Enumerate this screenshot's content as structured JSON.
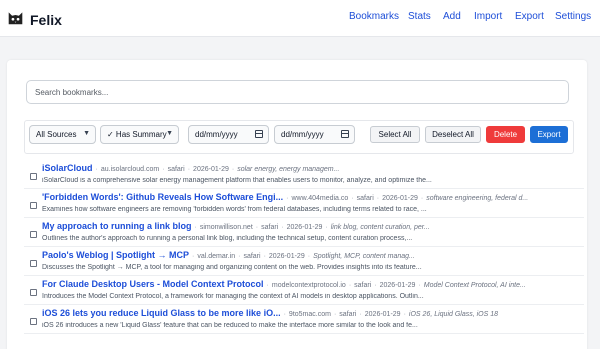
{
  "app": {
    "name": "Felix",
    "logo_icon": "cat-face-icon"
  },
  "nav": {
    "bookmarks": "Bookmarks",
    "stats": "Stats",
    "add": "Add",
    "import": "Import",
    "export": "Export",
    "settings": "Settings"
  },
  "search": {
    "placeholder": "Search bookmarks...",
    "value": ""
  },
  "filters": {
    "source": "All Sources",
    "summary": "✓ Has Summary",
    "date_from": "dd/mm/yyyy",
    "date_to": "dd/mm/yyyy",
    "select_all": "Select All",
    "deselect_all": "Deselect All",
    "delete": "Delete",
    "export": "Export"
  },
  "colors": {
    "accent": "#1d4ed8",
    "delete": "#ef3b3b",
    "export": "#1d6fd6"
  },
  "bookmarks": [
    {
      "title": "iSolarCloud",
      "domain": "au.isolarcloud.com",
      "browser": "safari",
      "date": "2026-01-29",
      "tags": "solar energy, energy managem...",
      "description": "iSolarCloud is a comprehensive solar energy management platform that enables users to monitor, analyze, and optimize the..."
    },
    {
      "title": "'Forbidden Words': Github Reveals How Software Engi...",
      "domain": "www.404media.co",
      "browser": "safari",
      "date": "2026-01-29",
      "tags": "software engineering, federal d...",
      "description": "Examines how software engineers are removing 'forbidden words' from federal databases, including terms related to race, ..."
    },
    {
      "title": "My approach to running a link blog",
      "domain": "simonwillison.net",
      "browser": "safari",
      "date": "2026-01-29",
      "tags": "link blog, content curation, per...",
      "description": "Outlines the author's approach to running a personal link blog, including the technical setup, content curation process,..."
    },
    {
      "title": "Paolo's Weblog | Spotlight → MCP",
      "domain": "val.demar.in",
      "browser": "safari",
      "date": "2026-01-29",
      "tags": "Spotlight, MCP, content manag...",
      "description": "Discusses the Spotlight → MCP, a tool for managing and organizing content on the web. Provides insights into its feature..."
    },
    {
      "title": "For Claude Desktop Users - Model Context Protocol",
      "domain": "modelcontextprotocol.io",
      "browser": "safari",
      "date": "2026-01-29",
      "tags": "Model Context Protocol, AI inte...",
      "description": "Introduces the Model Context Protocol, a framework for managing the context of AI models in desktop applications. Outlin..."
    },
    {
      "title": "iOS 26 lets you reduce Liquid Glass to be more like iO...",
      "domain": "9to5mac.com",
      "browser": "safari",
      "date": "2026-01-29",
      "tags": "iOS 26, Liquid Glass, iOS 18",
      "description": "iOS 26 introduces a new 'Liquid Glass' feature that can be reduced to make the interface more similar to the look and fe..."
    }
  ]
}
